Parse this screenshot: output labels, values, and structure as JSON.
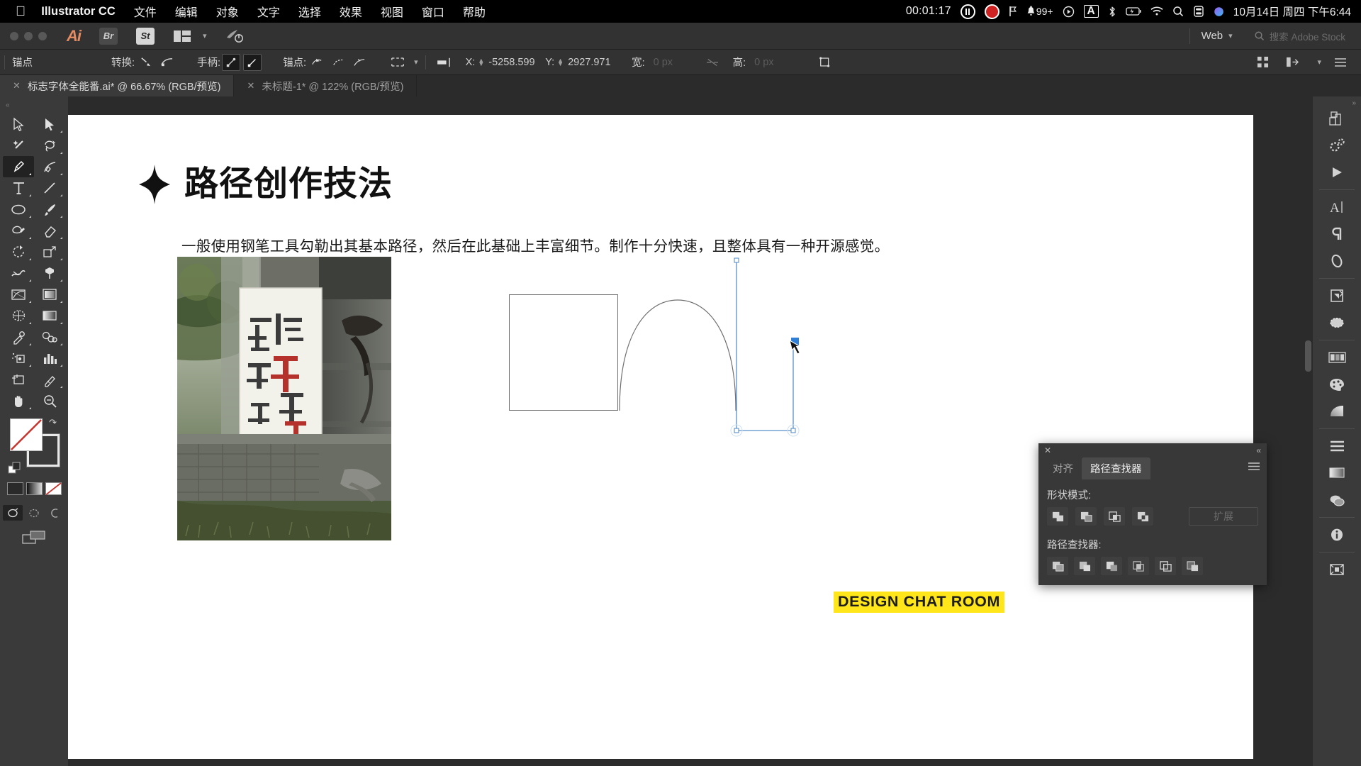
{
  "macbar": {
    "apple_icon": "apple-icon",
    "app_name": "Illustrator CC",
    "menus": [
      "文件",
      "编辑",
      "对象",
      "文字",
      "选择",
      "效果",
      "视图",
      "窗口",
      "帮助"
    ],
    "rec_time": "00:01:17",
    "pause_icon": "pause-recording-icon",
    "stop_icon": "stop-recording-icon",
    "flag_icon": "flag-icon",
    "notification_count": "99+",
    "play_icon": "play-circle-icon",
    "input_source": "A",
    "bluetooth_icon": "bluetooth-icon",
    "battery_icon": "battery-icon",
    "wifi_icon": "wifi-icon",
    "search_icon": "spotlight-search-icon",
    "control_center_icon": "control-center-icon",
    "siri_icon": "siri-icon",
    "datetime": "10月14日 周四 下午6:44"
  },
  "appbar": {
    "logo": "Ai",
    "bridge_label": "Br",
    "stock_label": "St",
    "arrange_icon": "arrange-documents-icon",
    "chevron_icon": "chevron-down-icon",
    "home_icon": "home-power-icon",
    "workspace_label": "Web",
    "workspace_chevron": "chevron-down-icon",
    "search_icon": "search-icon",
    "search_placeholder": "搜索 Adobe Stock"
  },
  "controlbar": {
    "selection_label": "锚点",
    "convert_label": "转换:",
    "convert_corner_icon": "convert-to-corner-icon",
    "convert_smooth_icon": "convert-to-smooth-icon",
    "handles_label": "手柄:",
    "handle_show_icon": "show-handles-icon",
    "handle_hide_icon": "hide-handles-icon",
    "anchor_label": "锚点:",
    "anchor_remove_icon": "remove-anchor-icon",
    "anchor_connect_icon": "connect-anchor-icon",
    "anchor_cut_icon": "cut-path-icon",
    "isolate_icon": "isolate-selected-icon",
    "align_icon": "align-objects-icon",
    "x_label": "X:",
    "x_value": "-5258.599",
    "y_label": "Y:",
    "y_value": "2927.971",
    "w_label": "宽:",
    "w_value": "0 px",
    "lock_icon": "constrain-proportions-icon",
    "h_label": "高:",
    "h_value": "0 px",
    "transform_icon": "transform-icon",
    "grid_icon": "grid-view-icon",
    "arrange_icon": "arrange-icon",
    "menu_icon": "panel-menu-icon"
  },
  "tabs": [
    {
      "label": "标志字体全能番.ai* @ 66.67% (RGB/预览)",
      "close_icon": "close-icon",
      "active": true
    },
    {
      "label": "未标题-1* @ 122% (RGB/预览)",
      "close_icon": "close-icon",
      "active": false
    }
  ],
  "toolbar": {
    "handle_icon": "panel-collapse-icon",
    "tools": [
      "selection-tool-icon",
      "direct-selection-tool-icon",
      "magic-wand-tool-icon",
      "lasso-tool-icon",
      "pen-tool-icon",
      "curvature-tool-icon",
      "type-tool-icon",
      "line-segment-tool-icon",
      "ellipse-tool-icon",
      "paintbrush-tool-icon",
      "shaper-tool-icon",
      "eraser-tool-icon",
      "rotate-tool-icon",
      "scale-tool-icon",
      "width-tool-icon",
      "free-transform-tool-icon",
      "shape-builder-tool-icon",
      "perspective-grid-tool-icon",
      "mesh-tool-icon",
      "gradient-tool-icon",
      "eyedropper-tool-icon",
      "blend-tool-icon",
      "symbol-sprayer-tool-icon",
      "column-graph-tool-icon",
      "artboard-tool-icon",
      "slice-tool-icon",
      "hand-tool-icon",
      "zoom-tool-icon"
    ],
    "fill_swatch": "fill-none-swatch",
    "stroke_swatch": "stroke-white-swatch",
    "swap_icon": "swap-fill-stroke-icon",
    "default_icon": "default-fill-stroke-icon",
    "color_modes": [
      "color-mode-icon",
      "gradient-mode-icon",
      "none-mode-icon"
    ],
    "draw_modes": [
      "draw-normal-icon",
      "draw-behind-icon",
      "draw-inside-icon"
    ],
    "screen_mode": "change-screen-mode-icon"
  },
  "document": {
    "star_icon": "four-point-star-icon",
    "title": "路径创作技法",
    "paragraph": "一般使用钢笔工具勾勒出其基本路径，然后在此基础上丰富细节。制作十分快速，且整体具有一种开源感觉。",
    "photo_alt": "moca-shanghai-poster-photo",
    "banner_text": "DESIGN CHAT ROOM",
    "banner_bg": "#ffe61a",
    "shapes": {
      "square": "square-path",
      "arc": "arc-path",
      "u_path": "u-shaped-open-path"
    },
    "cursor_icon": "pen-tool-cursor"
  },
  "pathfinder": {
    "close_icon": "close-icon",
    "collapse_icon": "collapse-panel-icon",
    "tabs": [
      {
        "label": "对齐",
        "active": false
      },
      {
        "label": "路径查找器",
        "active": true
      }
    ],
    "menu_icon": "panel-menu-icon",
    "shape_modes_label": "形状模式:",
    "shape_mode_buttons": [
      "unite-icon",
      "minus-front-icon",
      "intersect-icon",
      "exclude-icon"
    ],
    "expand_label": "扩展",
    "pathfinders_label": "路径查找器:",
    "pathfinder_buttons": [
      "divide-icon",
      "trim-icon",
      "merge-icon",
      "crop-icon",
      "outline-icon",
      "minus-back-icon"
    ]
  },
  "rightdock": {
    "handle_icon": "panel-expand-icon",
    "icons": [
      "layers-panel-icon",
      "properties-panel-icon",
      "actions-panel-icon",
      "character-panel-icon",
      "paragraph-panel-icon",
      "opacity-panel-icon",
      "transform-panel-icon",
      "pathfinder-panel-icon",
      "artboards-panel-icon",
      "color-panel-icon",
      "gradient-panel-icon",
      "align-panel-icon",
      "swatches-panel-icon",
      "appearance-panel-icon",
      "info-panel-icon",
      "asset-export-panel-icon"
    ]
  },
  "colors": {
    "app_bg": "#323232",
    "panel_bg": "#3a3a3a",
    "canvas_bg": "#2b2b2b",
    "accent": "#ffe61a",
    "selection_blue": "#4a90d9"
  }
}
